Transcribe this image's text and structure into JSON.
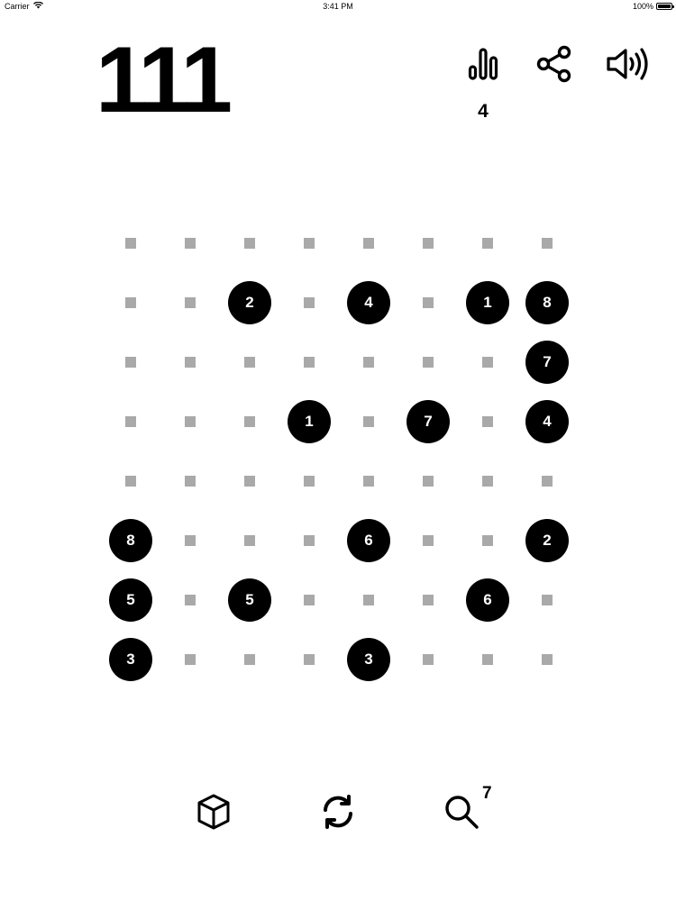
{
  "status_bar": {
    "carrier": "Carrier",
    "time": "3:41 PM",
    "battery": "100%"
  },
  "score": "111",
  "toolbar": {
    "stats_count": "4",
    "icons": [
      "stats-icon",
      "share-icon",
      "sound-icon"
    ]
  },
  "board": {
    "size": 8,
    "cells": [
      [
        "",
        "",
        "",
        "",
        "",
        "",
        "",
        ""
      ],
      [
        "",
        "",
        "2",
        "",
        "4",
        "",
        "1",
        "8"
      ],
      [
        "",
        "",
        "",
        "",
        "",
        "",
        "",
        "7"
      ],
      [
        "",
        "",
        "",
        "1",
        "",
        "7",
        "",
        "4"
      ],
      [
        "",
        "",
        "",
        "",
        "",
        "",
        "",
        ""
      ],
      [
        "8",
        "",
        "",
        "",
        "6",
        "",
        "",
        "2"
      ],
      [
        "5",
        "",
        "5",
        "",
        "",
        "",
        "6",
        ""
      ],
      [
        "3",
        "",
        "",
        "",
        "3",
        "",
        "",
        ""
      ]
    ]
  },
  "bottom_bar": {
    "icons": [
      "cube-icon",
      "refresh-icon",
      "search-icon"
    ],
    "hint_count": "7"
  },
  "colors": {
    "ball": "#000000",
    "ball_text": "#ffffff",
    "empty_dot": "#a9a9a9",
    "background": "#ffffff"
  }
}
